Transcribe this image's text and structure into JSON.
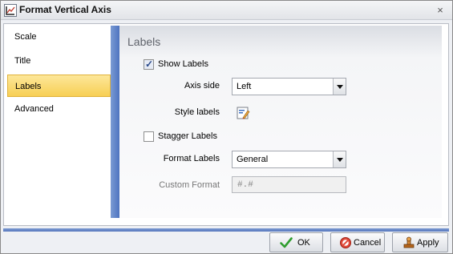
{
  "window": {
    "title": "Format Vertical Axis",
    "close_glyph": "×"
  },
  "nav": {
    "items": [
      {
        "label": "Scale",
        "selected": false
      },
      {
        "label": "Title",
        "selected": false
      },
      {
        "label": "Labels",
        "selected": true
      },
      {
        "label": "Advanced",
        "selected": false
      }
    ]
  },
  "section": {
    "title": "Labels"
  },
  "form": {
    "show_labels": {
      "label": "Show Labels",
      "checked": true
    },
    "axis_side": {
      "label": "Axis side",
      "value": "Left"
    },
    "style_labels": {
      "label": "Style labels",
      "icon": "style-labels-icon"
    },
    "stagger_labels": {
      "label": "Stagger Labels",
      "checked": false
    },
    "format_labels": {
      "label": "Format Labels",
      "value": "General"
    },
    "custom_format": {
      "label": "Custom Format",
      "value": "#.#",
      "disabled": true
    }
  },
  "buttons": {
    "ok": "OK",
    "cancel": "Cancel",
    "apply": "Apply"
  },
  "colors": {
    "selected_nav": "#f7cf54",
    "separator": "#5878bd"
  }
}
